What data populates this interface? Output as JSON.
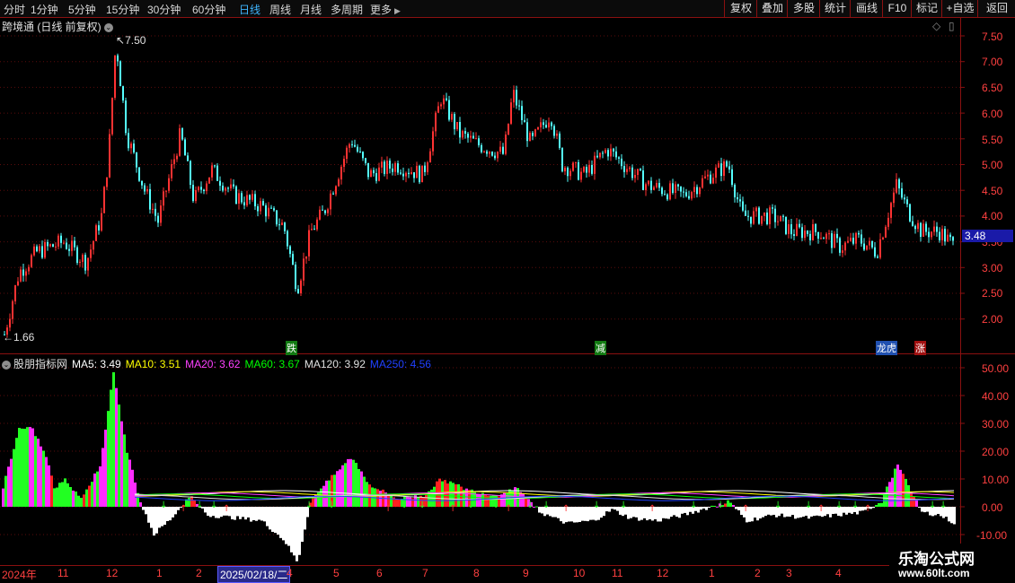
{
  "toolbar": {
    "periods": [
      "分时",
      "1分钟",
      "5分钟",
      "15分钟",
      "30分钟",
      "60分钟",
      "日线",
      "周线",
      "月线",
      "多周期",
      "更多"
    ],
    "more_arrow": "▶",
    "active_period": "日线",
    "buttons": [
      "复权",
      "叠加",
      "多股",
      "统计",
      "画线",
      "F10",
      "标记",
      "+自选",
      "返回"
    ]
  },
  "main_chart": {
    "title": "跨境通 (日线 前复权)",
    "y_ticks": [
      "7.50",
      "7.00",
      "6.50",
      "6.00",
      "5.50",
      "5.00",
      "4.50",
      "4.00",
      "3.50",
      "3.00",
      "2.50",
      "2.00"
    ],
    "last_price": "3.48",
    "max_label": "7.50",
    "min_label": "1.66",
    "badges": [
      {
        "text": "跌",
        "color": "#1fb01f"
      },
      {
        "text": "减",
        "color": "#1fb01f"
      },
      {
        "text": "龙虎",
        "color": "#3060d0"
      },
      {
        "text": "涨",
        "color": "#c01818"
      }
    ],
    "colors": {
      "up": "#ff3232",
      "down": "#54ffff"
    }
  },
  "indicator": {
    "name": "股朋指标网",
    "ma_values": [
      {
        "label": "MA5: 3.49",
        "color": "#ffffff"
      },
      {
        "label": "MA10: 3.51",
        "color": "#ffff00"
      },
      {
        "label": "MA20: 3.62",
        "color": "#ff40ff"
      },
      {
        "label": "MA60: 3.67",
        "color": "#00ff00"
      },
      {
        "label": "MA120: 3.92",
        "color": "#e0e0e0"
      },
      {
        "label": "MA250: 4.56",
        "color": "#2040ff"
      }
    ],
    "y_ticks": [
      "50.00",
      "40.00",
      "30.00",
      "20.00",
      "10.00",
      "0.00",
      "-10.00"
    ]
  },
  "dates": {
    "labels": [
      "2024年",
      "11",
      "12",
      "1",
      "2",
      "4",
      "5",
      "6",
      "7",
      "8",
      "9",
      "10",
      "11",
      "12",
      "1",
      "2",
      "3",
      "4"
    ],
    "selected": "2025/02/18/二"
  },
  "watermark": {
    "line1": "乐淘公式网",
    "line2": "www.60lt.com"
  }
}
